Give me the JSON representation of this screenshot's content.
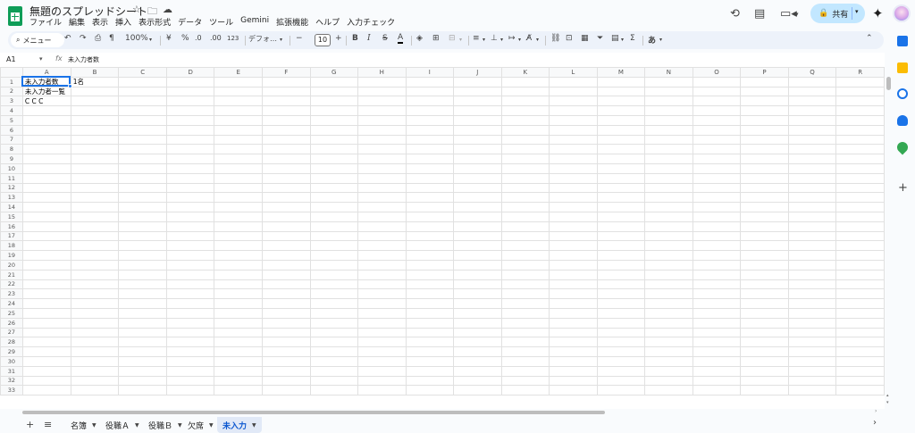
{
  "app": {
    "title": "無題のスプレッドシート",
    "menus": [
      "ファイル",
      "編集",
      "表示",
      "挿入",
      "表示形式",
      "データ",
      "ツール",
      "Gemini",
      "拡張機能",
      "ヘルプ",
      "入力チェック"
    ],
    "share_label": "共有"
  },
  "toolbar": {
    "search_label": "メニュー",
    "zoom": "100%",
    "currency": "¥",
    "percent": "%",
    "decimal_decrease": ".0",
    "decimal_increase": ".00",
    "number_format": "123",
    "font": "デフォ…",
    "font_size": "10",
    "bold": "B",
    "italic": "I",
    "strike": "S",
    "text_color": "A",
    "sum": "Σ",
    "input_tools": "あ"
  },
  "formula_bar": {
    "name_box": "A1",
    "fx": "fx",
    "content": "未入力者数"
  },
  "grid": {
    "columns": [
      "A",
      "B",
      "C",
      "D",
      "E",
      "F",
      "G",
      "H",
      "I",
      "J",
      "K",
      "L",
      "M",
      "N",
      "O",
      "P",
      "Q",
      "R"
    ],
    "row_count": 33,
    "cells": {
      "A1": "未入力者数",
      "B1": "1名",
      "A2": "未入力者一覧",
      "A3": "C C C"
    },
    "selected_cell": "A1"
  },
  "sheets": {
    "tabs": [
      "名簿",
      "役職Ａ",
      "役職Ｂ",
      "欠席",
      "未入力"
    ],
    "active": "未入力"
  },
  "colors": {
    "accent": "#0b57d0",
    "selection": "#1a73e8",
    "share_bg": "#c2e7ff",
    "sheets_green": "#0f9d58"
  }
}
